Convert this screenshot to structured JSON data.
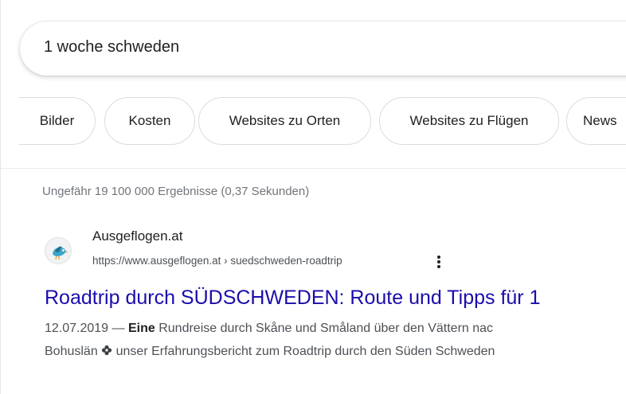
{
  "search": {
    "query": "1 woche schweden"
  },
  "chips": [
    {
      "label": "Bilder"
    },
    {
      "label": "Kosten"
    },
    {
      "label": "Websites zu Orten"
    },
    {
      "label": "Websites zu Flügen"
    },
    {
      "label": "News"
    }
  ],
  "stats": {
    "text": "Ungefähr 19 100 000 Ergebnisse (0,37 Sekunden)"
  },
  "result": {
    "favicon": "bird-logo-icon",
    "site_name": "Ausgeflogen.at",
    "url": "https://www.ausgeflogen.at › suedschweden-roadtrip",
    "more_icon": "vertical-dots-icon",
    "title": "Roadtrip durch SÜDSCHWEDEN: Route und Tipps für 1",
    "snippet": {
      "date": "12.07.2019",
      "dash": " — ",
      "bold": "Eine",
      "line1_rest": " Rundreise durch Skåne und Småland über den Vättern nac",
      "line2_start": "Bohuslän ",
      "separator_icon": "flower-icon",
      "line2_rest": " unser Erfahrungsbericht zum Roadtrip durch den Süden Schweden"
    }
  },
  "colors": {
    "link": "#1a0dab",
    "text": "#202124",
    "muted": "#70757a",
    "border": "#dadce0"
  }
}
